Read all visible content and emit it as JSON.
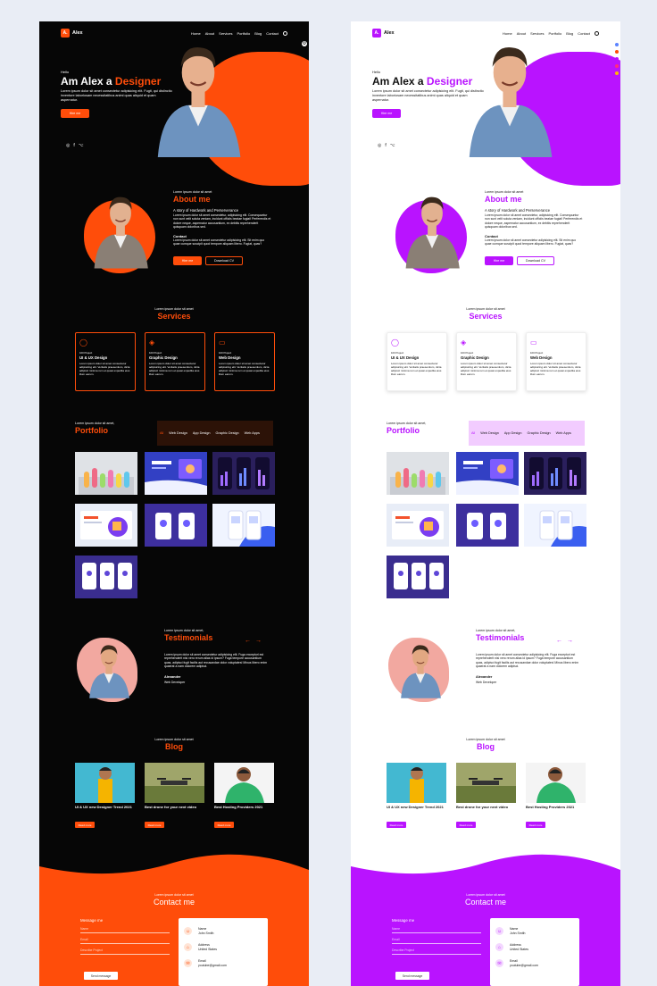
{
  "brand": {
    "logo_letter": "A.",
    "name": "Alex"
  },
  "nav": {
    "items": [
      "Home",
      "About",
      "Services",
      "Portfolio",
      "Blog",
      "Contact"
    ]
  },
  "hero": {
    "greeting": "Hello",
    "title_prefix": "Am Alex a ",
    "title_highlight": "Designer",
    "text": "Lorem ipsum dolor sit amet consectetur adipisicing elit. Fugit, qui distinctio inventore laboriosam necessitatibus animi quas aliquid et quam aspernatur.",
    "cta": "Hire me",
    "socials": [
      "◎",
      "f",
      "⌥"
    ]
  },
  "about": {
    "kicker": "Lorem ipsum dolor sit amet",
    "title": "About me",
    "subtitle": "A story of Hardwork and Perserverance",
    "text": "Lorem ipsum dolor sit amet consectetur, adipisicing elit. Consequuntur non sunt velit soluta veniam, incidunt officiis beatae fugiat! Perferendis et dolore neque, aspernatur accusantium, ex debitis reprehenderit quisquam doloribus sed.",
    "contact_label": "Contact",
    "contact_text": "Lorem ipsum dolor sit amet consectetur adipisicing elit. Sit enim quo quae cumque suscipit quod tempore aliquam libero. Fugiat, quas?",
    "hire_btn": "Hire me",
    "cv_btn": "Download CV"
  },
  "services": {
    "kicker": "Lorem ipsum dolor sit amet",
    "title": "Services",
    "cards": [
      {
        "icon": "lightbulb-icon",
        "glyph": "◯",
        "category": "100 Project",
        "title": "UI & UX Design",
        "text": "Lorem ipsum dolor sit amet consectetur adipisicing elit. Veritatis praesentium, dicta adipisci minima rem et quasi expedita eius illum earum."
      },
      {
        "icon": "layers-icon",
        "glyph": "◈",
        "category": "100 Project",
        "title": "Graphic Design",
        "text": "Lorem ipsum dolor sit amet consectetur adipisicing elit. Veritatis praesentium, dicta adipisci minima rem et quasi expedita eius illum earum."
      },
      {
        "icon": "monitor-icon",
        "glyph": "▭",
        "category": "100 Project",
        "title": "Web Design",
        "text": "Lorem ipsum dolor sit amet consectetur adipisicing elit. Veritatis praesentium, dicta adipisci minima rem et quasi expedita eius illum earum."
      }
    ]
  },
  "portfolio": {
    "kicker": "Lorem ipsum dolor sit amet,",
    "title": "Portfolio",
    "tabs": [
      "All",
      "Web Design",
      "App Design",
      "Graphic Design",
      "Web Apps"
    ]
  },
  "testimonials": {
    "kicker": "Lorem ipsum dolor sit amet,",
    "title": "Testimonials",
    "quote": "Lorem ipsum dolor sit amet consectetur adipisicing elit. Fuga excepturi est reprehenderit nisi vero rerum alias id ipsum? Fuga tempore accusantium quas, adipisci fugit facilis aut recusandae dolor voluptates! Minus libero enim quaerat a nam dolorem adipisci.",
    "name": "Alexander",
    "role": "Web Developer"
  },
  "blog": {
    "kicker": "Lorem ipsum dolor sit amet",
    "title": "Blog",
    "posts": [
      {
        "title": "UI & UX new Designer Trend 2021",
        "read_more": "Read more"
      },
      {
        "title": "Best drone for your next video",
        "read_more": "Read more"
      },
      {
        "title": "Best Hosting Providers 2021",
        "read_more": "Read more"
      }
    ]
  },
  "contact": {
    "kicker": "Lorem ipsum dolor sit amet",
    "title": "Contact me",
    "form_title": "Message me",
    "fields": [
      "Name",
      "Email",
      "Describe Project"
    ],
    "send": "Send message",
    "info": [
      {
        "label": "Name",
        "value": "John Smith",
        "glyph": "☺"
      },
      {
        "label": "Address",
        "value": "United States",
        "glyph": "⌂"
      },
      {
        "label": "Email",
        "value": "youtube@gmail.com",
        "glyph": "✉"
      }
    ]
  },
  "themes": {
    "dark_accent": "#ff4d0a",
    "light_accent": "#b913ff"
  }
}
